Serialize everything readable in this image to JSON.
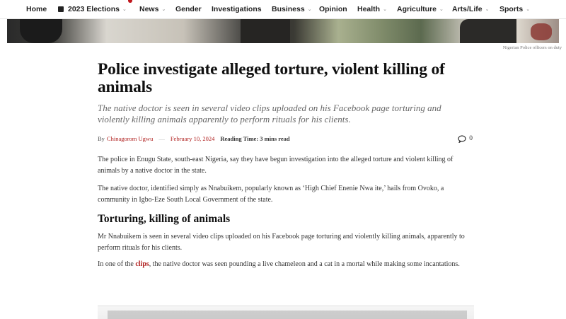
{
  "nav": {
    "items": [
      {
        "label": "Home",
        "has_dropdown": false,
        "icon": null
      },
      {
        "label": "2023 Elections",
        "has_dropdown": true,
        "icon": "calendar-icon"
      },
      {
        "label": "News",
        "has_dropdown": true,
        "icon": null
      },
      {
        "label": "Gender",
        "has_dropdown": false,
        "icon": null
      },
      {
        "label": "Investigations",
        "has_dropdown": false,
        "icon": null
      },
      {
        "label": "Business",
        "has_dropdown": true,
        "icon": null
      },
      {
        "label": "Opinion",
        "has_dropdown": false,
        "icon": null
      },
      {
        "label": "Health",
        "has_dropdown": true,
        "icon": null
      },
      {
        "label": "Agriculture",
        "has_dropdown": true,
        "icon": null
      },
      {
        "label": "Arts/Life",
        "has_dropdown": true,
        "icon": null
      },
      {
        "label": "Sports",
        "has_dropdown": true,
        "icon": null
      }
    ],
    "chevron": "⌄"
  },
  "hero": {
    "caption": "Nigerian Police officers on duty"
  },
  "article": {
    "headline": "Police investigate alleged torture, violent killing of animals",
    "subtitle": "The native doctor is seen in several video clips uploaded on his Facebook page torturing and violently killing animals apparently to perform rituals for his clients.",
    "meta": {
      "by": "By",
      "author": "Chinagorom Ugwu",
      "separator": "—",
      "date": "February 10, 2024",
      "reading_time": "Reading Time: 3 mins read",
      "comment_count": "0"
    },
    "paragraphs": {
      "p1": "The police in Enugu State, south-east Nigeria, say they have begun investigation into the alleged torture and violent killing of animals by a native doctor in the state.",
      "p2": "The native doctor, identified simply as Nnabuikem, popularly known as ‘High Chief Enenie Nwa ite,’ hails from Ovoko, a community in Igbo-Eze South Local Government of the state.",
      "section_heading": "Torturing, killing of animals",
      "p3": "Mr Nnabuikem is seen in several video clips uploaded on his Facebook page torturing and violently killing animals, apparently to perform rituals for his clients.",
      "p4_before": "In one of the ",
      "p4_link": "clips",
      "p4_after": ", the native doctor was seen pounding a live chameleon and a cat in a mortal while making some incantations."
    }
  },
  "colors": {
    "accent": "#b0201f",
    "text": "#333333",
    "heading": "#111111"
  }
}
